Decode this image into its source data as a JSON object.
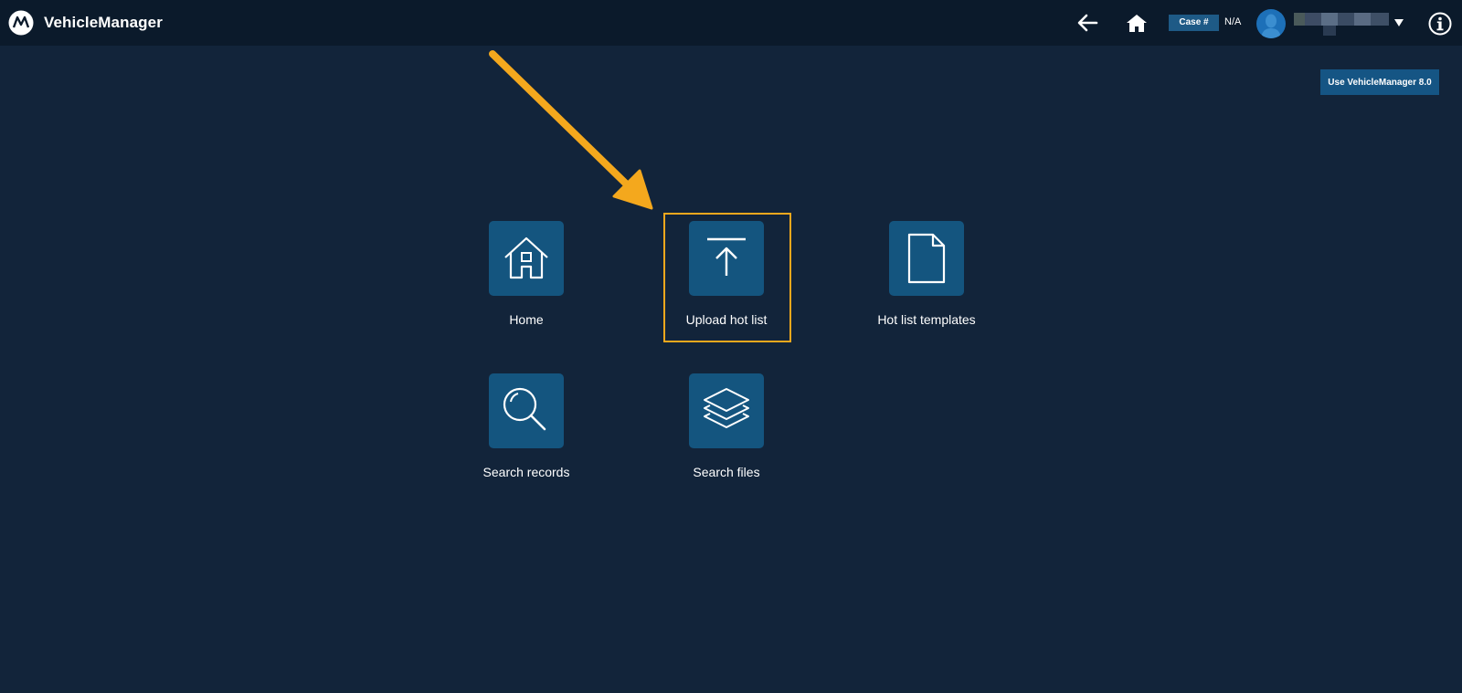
{
  "app": {
    "title": "VehicleManager"
  },
  "header": {
    "back_icon": "arrow-left-icon",
    "home_icon": "house-icon",
    "case_label": "Case #",
    "case_value": "N/A",
    "info_icon": "info-icon"
  },
  "actions": {
    "use_vm_label": "Use VehicleManager 8.0"
  },
  "tiles": [
    {
      "label": "Home",
      "icon": "home-icon"
    },
    {
      "label": "Upload hot list",
      "icon": "upload-icon"
    },
    {
      "label": "Hot list templates",
      "icon": "document-icon"
    },
    {
      "label": "Search records",
      "icon": "magnifier-icon"
    },
    {
      "label": "Search files",
      "icon": "layers-icon"
    }
  ],
  "colors": {
    "background": "#12243a",
    "topbar": "#0b1a2b",
    "tile": "#14557f",
    "highlight": "#f4a81d",
    "avatar": "#1d70b8"
  }
}
